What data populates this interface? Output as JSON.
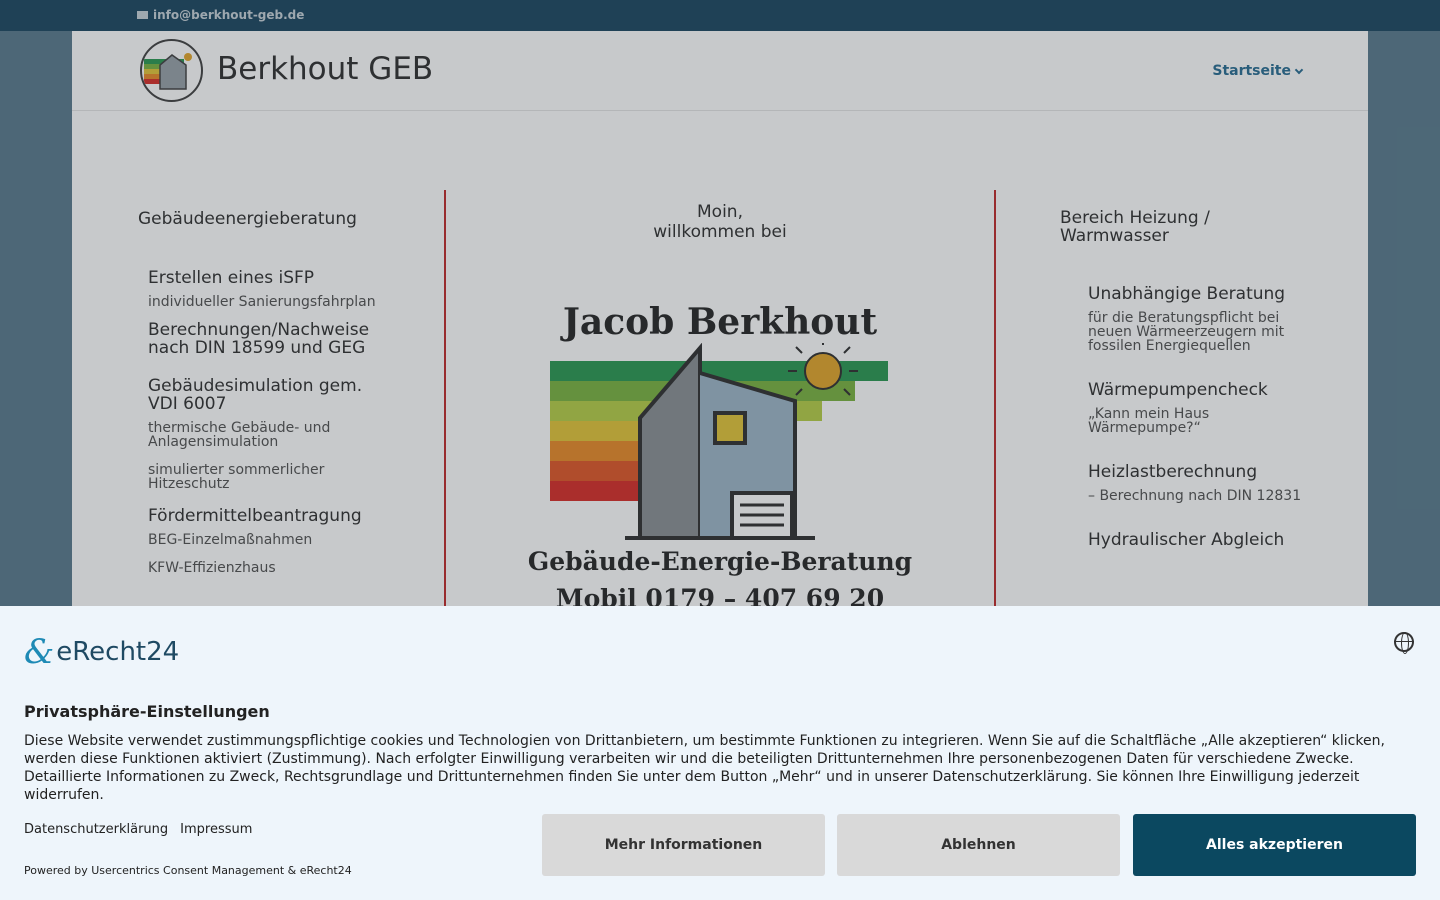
{
  "topbar": {
    "email": "info@berkhout-geb.de"
  },
  "header": {
    "brand": "Berkhout GEB",
    "nav_item": "Startseite"
  },
  "left": {
    "heading": "Gebäudeenergieberatung",
    "items": [
      {
        "title": "Erstellen eines iSFP",
        "subs": [
          "individueller Sanierungsfahrplan"
        ]
      },
      {
        "title": "Berechnungen/Nachweise\nnach DIN 18599 und GEG",
        "subs": []
      },
      {
        "title": "Gebäudesimulation gem. VDI 6007",
        "subs": [
          "thermische Gebäude- und Anlagensimulation",
          "simulierter sommerlicher Hitzeschutz"
        ]
      },
      {
        "title": "Fördermittelbeantragung",
        "subs": [
          "BEG-Einzelmaßnahmen",
          "KFW-Effizienzhaus"
        ]
      }
    ]
  },
  "center": {
    "greeting_line1": "Moin,",
    "greeting_line2": "willkommen bei",
    "name": "Jacob Berkhout",
    "tagline": "Gebäude-Energie-Beratung",
    "phone": "Mobil 0179 – 407 69 20"
  },
  "right": {
    "heading": "Bereich Heizung / Warmwasser",
    "items": [
      {
        "title": "Unabhängige Beratung",
        "sub": "für die Beratungspflicht bei neuen Wärmeerzeugern mit fossilen Energiequellen"
      },
      {
        "title": "Wärmepumpencheck",
        "sub": "„Kann mein Haus Wärmepumpe?“"
      },
      {
        "title": "Heizlastberechnung",
        "sub": "– Berechnung nach DIN 12831"
      },
      {
        "title": "Hydraulischer Abgleich",
        "sub": ""
      }
    ]
  },
  "consent": {
    "logo_text": "eRecht24",
    "title": "Privatsphäre-Einstellungen",
    "body": "Diese Website verwendet zustimmungspflichtige cookies und Technologien von Drittanbietern, um bestimmte Funktionen zu integrieren. Wenn Sie auf die Schaltfläche „Alle akzeptieren“ klicken, werden diese Funktionen aktiviert (Zustimmung). Nach erfolgter Einwilligung verarbeiten wir und die beteiligten Drittunternehmen Ihre personenbezogenen Daten für verschiedene Zwecke. Detaillierte Informationen zu Zweck, Rechtsgrundlage und Drittunternehmen finden Sie unter dem Button „Mehr“ und in unserer Datenschutzerklärung. Sie können Ihre Einwilligung jederzeit widerrufen.",
    "link_privacy": "Datenschutzerklärung",
    "link_imprint": "Impressum",
    "powered": "Powered by Usercentrics Consent Management & eRecht24",
    "btn_more": "Mehr Informationen",
    "btn_decline": "Ablehnen",
    "btn_accept": "Alles akzeptieren"
  },
  "colors": {
    "accent": "#0b4860",
    "rule": "#c12c2c",
    "nav": "#2c6f94"
  }
}
